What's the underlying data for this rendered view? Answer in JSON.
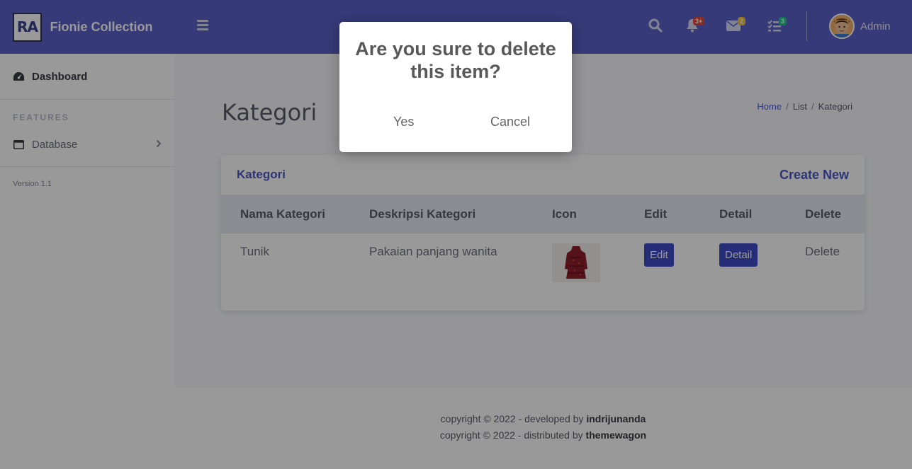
{
  "brand": {
    "logo_text": "RA",
    "name": "Fionie Collection"
  },
  "sidebar": {
    "dashboard_label": "Dashboard",
    "section_label": "FEATURES",
    "database_label": "Database",
    "version": "Version 1.1"
  },
  "topbar": {
    "alerts_badge": "3+",
    "messages_badge": "2",
    "tasks_badge": "3",
    "user_name": "Admin",
    "colors": {
      "alerts": "#e74a3b",
      "messages": "#f6c23e",
      "tasks": "#1cc88a"
    }
  },
  "page": {
    "title": "Kategori",
    "breadcrumb": [
      "Home",
      "List",
      "Kategori"
    ]
  },
  "card": {
    "title": "Kategori",
    "create_label": "Create New",
    "columns": [
      "Nama Kategori",
      "Deskripsi Kategori",
      "Icon",
      "Edit",
      "Detail",
      "Delete"
    ],
    "rows": [
      {
        "nama": "Tunik",
        "deskripsi": "Pakaian panjang wanita",
        "icon": "dress-thumbnail",
        "edit": "Edit",
        "detail": "Detail",
        "delete": "Delete"
      }
    ]
  },
  "footer": {
    "line1_prefix": "copyright © 2022 - developed by",
    "line1_name": "indrijunanda",
    "line2_prefix": "copyright © 2022 - distributed by",
    "line2_name": "themewagon"
  },
  "modal": {
    "title": "Are you sure to delete this item?",
    "yes_label": "Yes",
    "cancel_label": "Cancel"
  }
}
